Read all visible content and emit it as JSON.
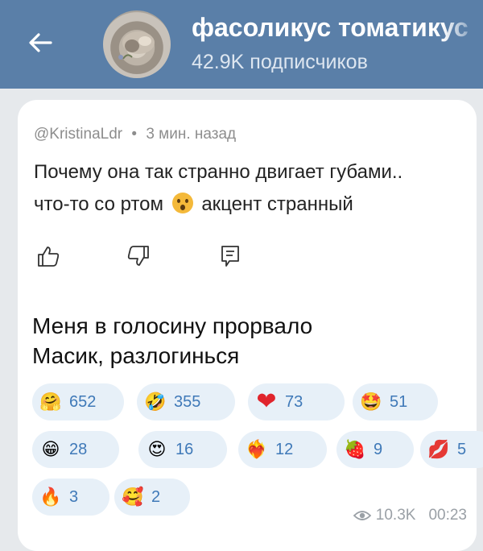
{
  "header": {
    "title": "фасоликус томатикус",
    "subscribers": "42.9K подписчиков"
  },
  "comment": {
    "author": "@KristinaLdr",
    "separator": "•",
    "time": "3 мин. назад",
    "line1": "Почему она так странно двигает губами..",
    "line2_before": "что-то со ртом",
    "line2_after": "акцент странный"
  },
  "post": {
    "line1": "Меня в голосину прорвало",
    "line2": "Масик, разлогинься"
  },
  "reactions": [
    {
      "emoji": "hugging-face",
      "glyph": "🤗",
      "count": "652"
    },
    {
      "emoji": "rolling-laughing",
      "glyph": "🤣",
      "count": "355"
    },
    {
      "emoji": "red-heart",
      "glyph": "❤",
      "count": "73"
    },
    {
      "emoji": "star-struck",
      "glyph": "🤩",
      "count": "51"
    },
    {
      "emoji": "grinning-face",
      "glyph": "😁",
      "count": "28"
    },
    {
      "emoji": "heart-eyes",
      "glyph": "😍",
      "count": "16"
    },
    {
      "emoji": "heart-on-fire",
      "glyph": "❤‍🔥",
      "count": "12"
    },
    {
      "emoji": "strawberry",
      "glyph": "🍓",
      "count": "9"
    },
    {
      "emoji": "kiss-mark",
      "glyph": "💋",
      "count": "5"
    },
    {
      "emoji": "fire",
      "glyph": "🔥",
      "count": "3"
    },
    {
      "emoji": "smiling-hearts",
      "glyph": "🥰",
      "count": "2"
    }
  ],
  "footer": {
    "views": "10.3K",
    "time": "00:23"
  },
  "colors": {
    "header": "#5a7fa8",
    "reaction_pill": "#e7f0f8",
    "reaction_count": "#3f79b8"
  }
}
